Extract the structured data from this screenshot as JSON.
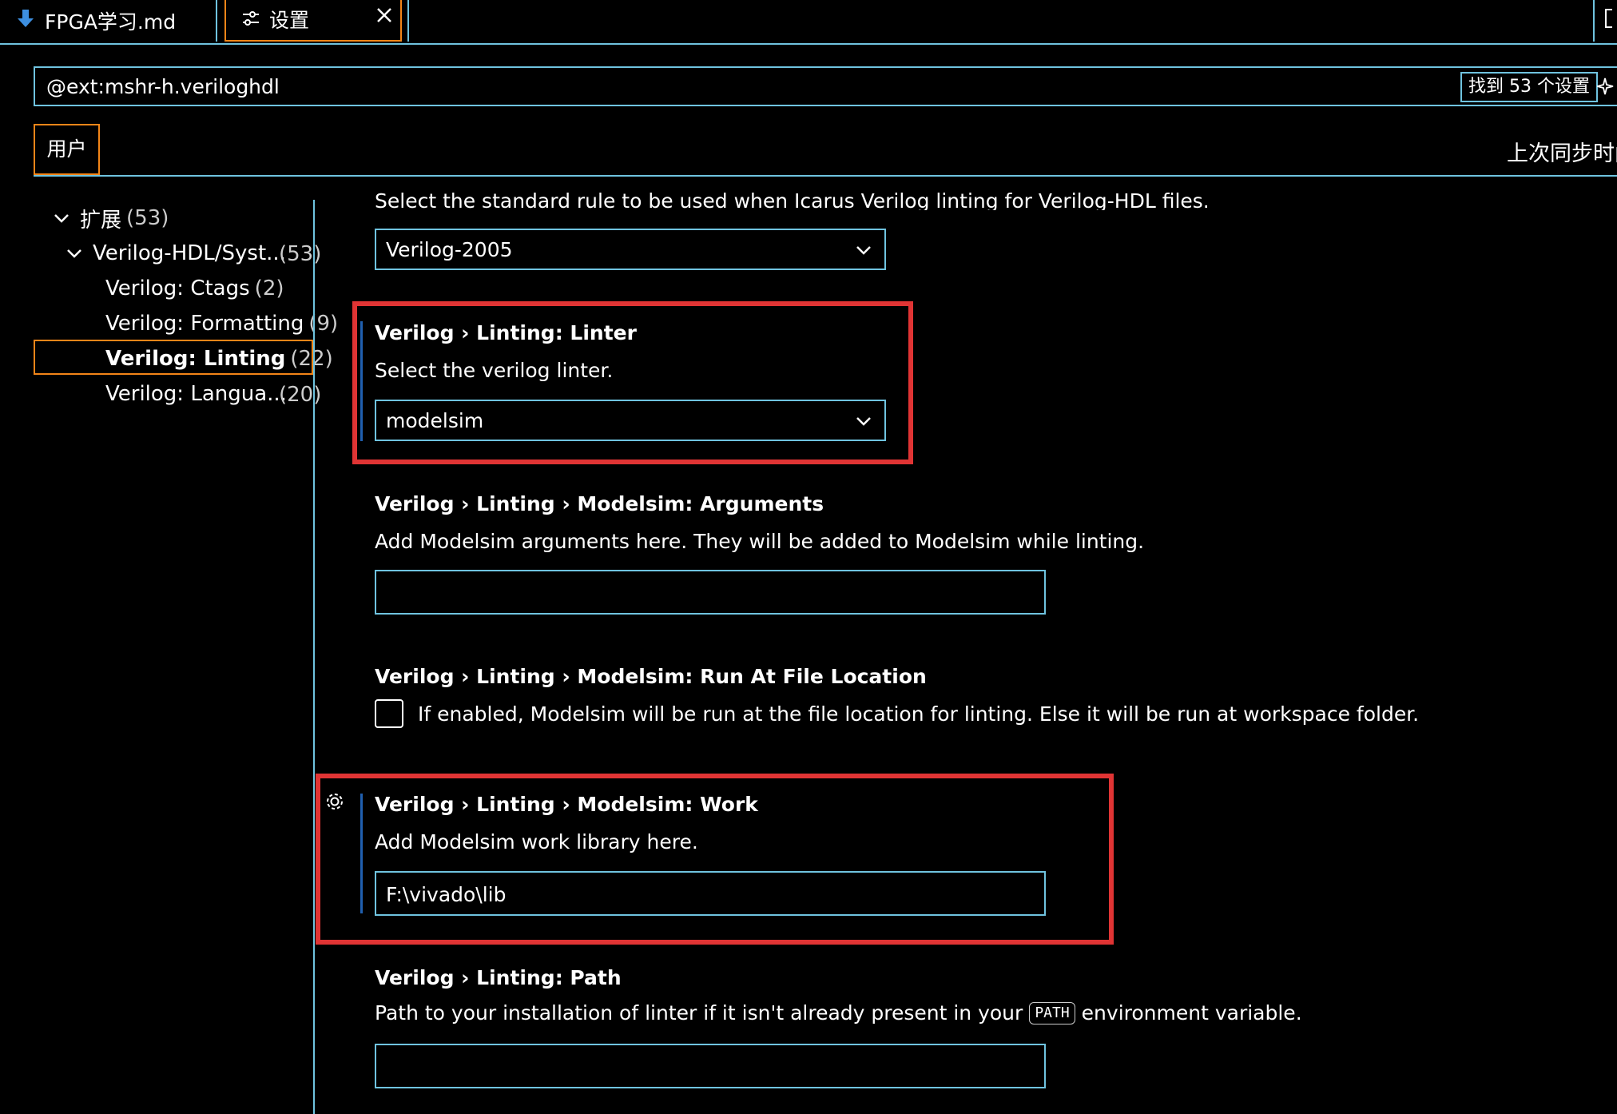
{
  "tabs": [
    {
      "label": "FPGA学习.md",
      "icon": "arrow-down-icon"
    },
    {
      "label": "设置",
      "icon": "settings-sliders-icon"
    }
  ],
  "search": {
    "value": "@ext:mshr-h.veriloghdl",
    "found": "找到 53 个设置"
  },
  "scope": {
    "user": "用户",
    "sync": "上次同步时间"
  },
  "tree": {
    "items": [
      {
        "label": "扩展",
        "count": "(53)"
      },
      {
        "label": "Verilog-HDL/Syst...",
        "count": "(53)"
      },
      {
        "label": "Verilog: Ctags",
        "count": "(2)"
      },
      {
        "label": "Verilog: Formatting",
        "count": "(9)"
      },
      {
        "label": "Verilog: Linting",
        "count": "(22)"
      },
      {
        "label": "Verilog: Langua...",
        "count": "(20)"
      }
    ]
  },
  "settings": {
    "standard": {
      "desc_partial": "Select the standard rule to be used when Icarus Verilog linting for Verilog-HDL files.",
      "value": "Verilog-2005"
    },
    "linter": {
      "title": "Verilog › Linting: Linter",
      "desc": "Select the verilog linter.",
      "value": "modelsim"
    },
    "args": {
      "title": "Verilog › Linting › Modelsim: Arguments",
      "desc": "Add Modelsim arguments here. They will be added to Modelsim while linting.",
      "value": ""
    },
    "run_at": {
      "title": "Verilog › Linting › Modelsim: Run At File Location",
      "desc": "If enabled, Modelsim will be run at the file location for linting. Else it will be run at workspace folder.",
      "checked": false
    },
    "work": {
      "title": "Verilog › Linting › Modelsim: Work",
      "desc": "Add Modelsim work library here.",
      "value": "F:\\vivado\\lib"
    },
    "path": {
      "title": "Verilog › Linting: Path",
      "desc_before": "Path to your installation of linter if it isn't already present in your",
      "code": "PATH",
      "desc_after": "environment variable.",
      "value": ""
    }
  },
  "colors": {
    "accent": "#6fc3df",
    "focus": "#f38518",
    "highlight": "#e03434",
    "modified": "#2060b0"
  }
}
